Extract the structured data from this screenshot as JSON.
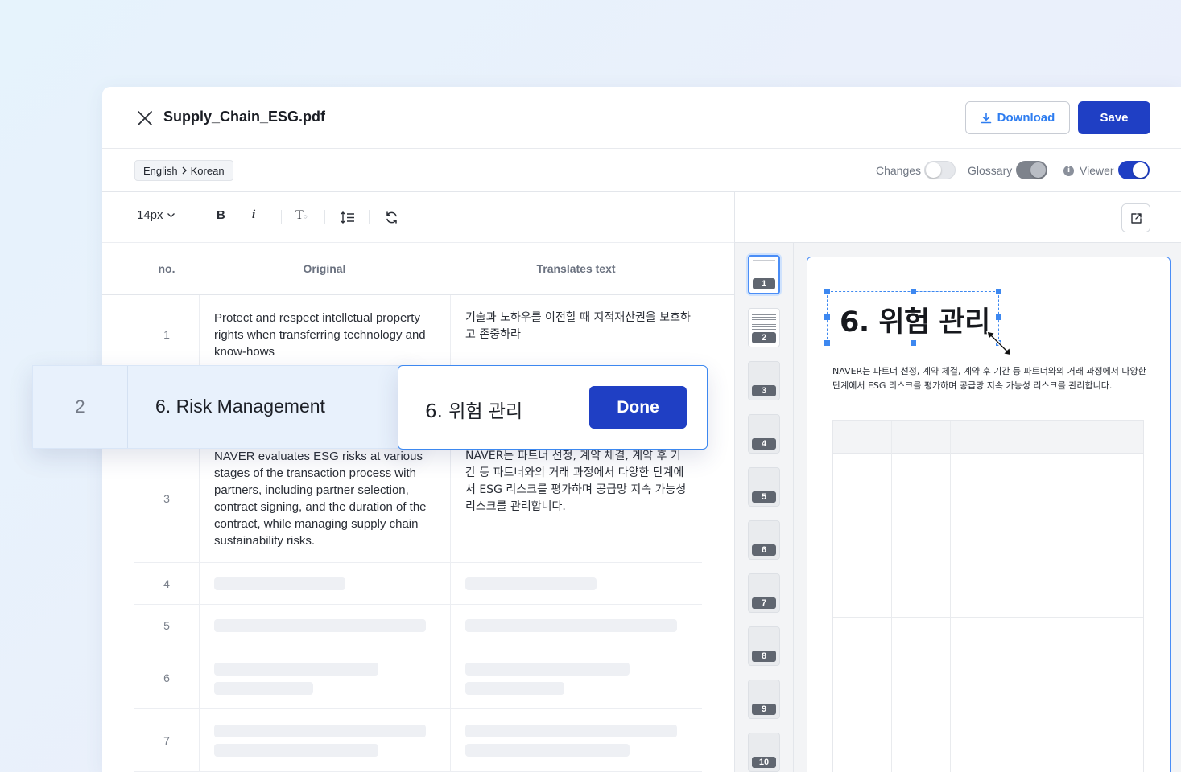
{
  "header": {
    "file_name": "Supply_Chain_ESG.pdf",
    "download_label": "Download",
    "save_label": "Save"
  },
  "subheader": {
    "source_lang": "English",
    "target_lang": "Korean",
    "toggles": [
      {
        "label": "Changes",
        "on": false
      },
      {
        "label": "Glossary",
        "on": false,
        "disabled": true
      },
      {
        "label": "Viewer",
        "on": true
      }
    ]
  },
  "toolbar": {
    "font_size": "14px"
  },
  "table": {
    "columns": [
      "no.",
      "Original",
      "Translates text"
    ],
    "rows": [
      {
        "no": "1",
        "original": "Protect and respect intellctual property rights when transferring technology and know-hows",
        "translated": "기술과 노하우를 이전할 때 지적재산권을 보호하고 존중하라"
      },
      {
        "no": "3",
        "original": "NAVER evaluates ESG risks at various stages of the transaction process with partners, including partner selection, contract signing, and the duration of the contract, while managing supply chain sustainability risks.",
        "translated": "NAVER는 파트너 선정, 계약 체결, 계약 후 기간 등 파트너와의 거래 과정에서 다양한 단계에서 ESG 리스크를 평가하며 공급망 지속 가능성 리스크를 관리합니다."
      },
      {
        "no": "4"
      },
      {
        "no": "5"
      },
      {
        "no": "6"
      },
      {
        "no": "7"
      }
    ]
  },
  "editing": {
    "no": "2",
    "original": "6. Risk Management",
    "translated": "6. 위험 관리",
    "done_label": "Done"
  },
  "thumbnails": [
    "1",
    "2",
    "3",
    "4",
    "5",
    "6",
    "7",
    "8",
    "9",
    "10"
  ],
  "viewer": {
    "title": "6. 위험 관리",
    "paragraph": "NAVER는 파트너 선정, 계약 체결, 계약 후 기간 등 파트너와의 거래 과정에서 다양한 단계에서 ESG 리스크를 평가하며 공급망 지속 가능성 리스크를 관리합니다."
  },
  "colors": {
    "primary": "#1f3fc4",
    "accent": "#3d88f0",
    "link": "#2e7df0"
  }
}
